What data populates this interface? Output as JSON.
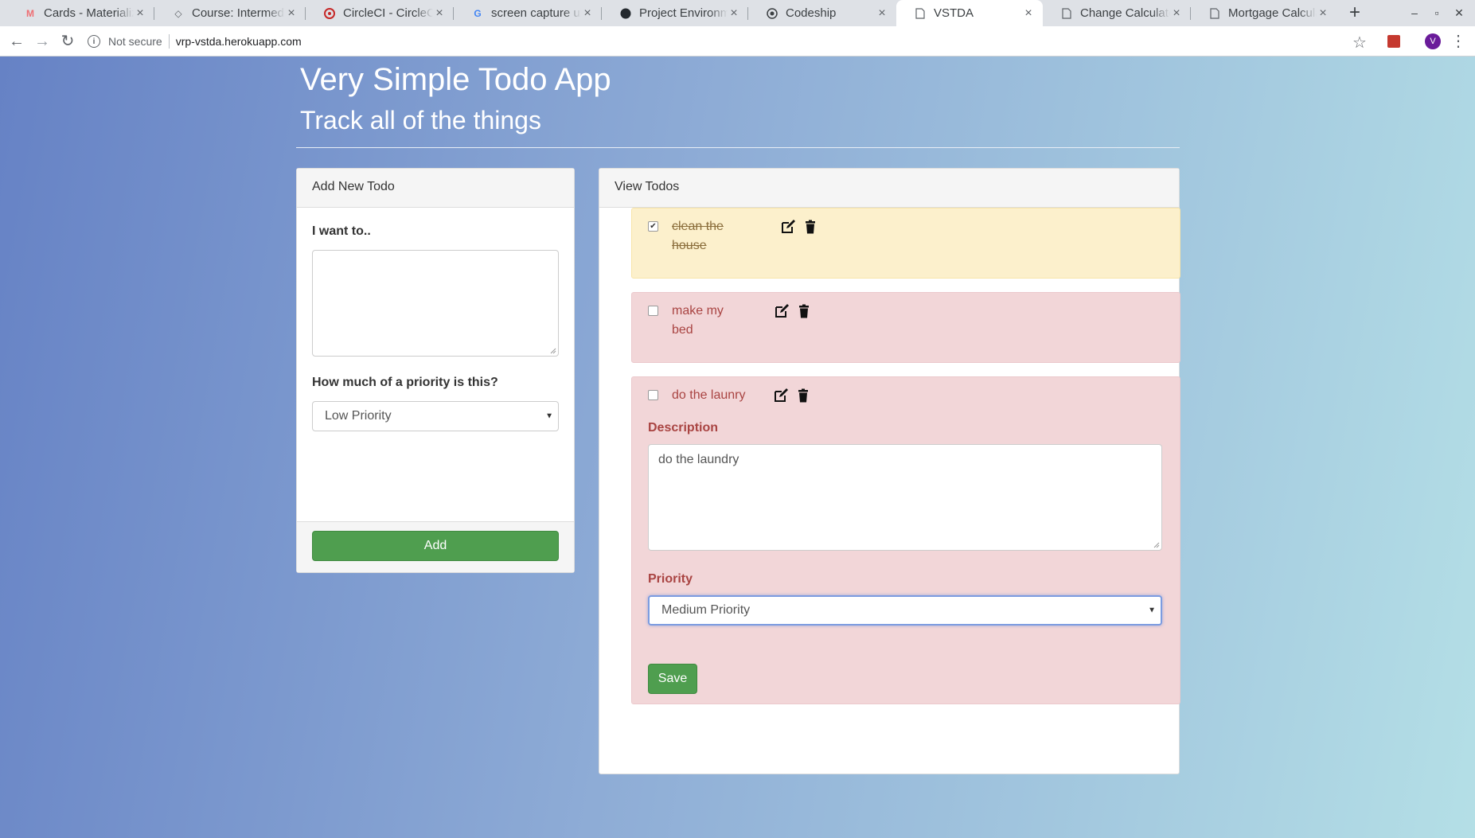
{
  "browser": {
    "tabs": [
      {
        "title": "Cards - Materialize",
        "icon": "materialize-icon",
        "active": false
      },
      {
        "title": "Course: Intermediate",
        "icon": "graduation-cap-icon",
        "active": false
      },
      {
        "title": "CircleCI - CircleCI",
        "icon": "circleci-icon",
        "active": false
      },
      {
        "title": "screen capture ubuntu",
        "icon": "google-icon",
        "active": false
      },
      {
        "title": "Project Environment",
        "icon": "github-icon",
        "active": false
      },
      {
        "title": "Codeship",
        "icon": "codeship-icon",
        "active": false
      },
      {
        "title": "VSTDA",
        "icon": "document-icon",
        "active": true
      },
      {
        "title": "Change Calculator",
        "icon": "document-icon",
        "active": false
      },
      {
        "title": "Mortgage Calculator",
        "icon": "document-icon",
        "active": false
      }
    ],
    "security_label": "Not secure",
    "url": "vrp-vstda.herokuapp.com",
    "avatar_letter": "V"
  },
  "header": {
    "title": "Very Simple Todo App",
    "subtitle": "Track all of the things"
  },
  "add_panel": {
    "heading": "Add New Todo",
    "todo_label": "I want to..",
    "todo_value": "",
    "priority_label": "How much of a priority is this?",
    "priority_selected": "Low Priority",
    "add_button": "Add"
  },
  "view_panel": {
    "heading": "View Todos",
    "todos": [
      {
        "text": "clean the house",
        "completed": true,
        "priority": "low"
      },
      {
        "text": "make my bed",
        "completed": false,
        "priority": "high"
      },
      {
        "text": "do the launry",
        "completed": false,
        "priority": "high",
        "editing": true
      }
    ],
    "edit_form": {
      "description_label": "Description",
      "description_value": "do the laundry",
      "priority_label": "Priority",
      "priority_selected": "Medium Priority",
      "save_button": "Save"
    }
  },
  "colors": {
    "completed_bg": "#fcf0cc",
    "high_priority_bg": "#f2d6d8",
    "success_green": "#4f9e4f"
  }
}
